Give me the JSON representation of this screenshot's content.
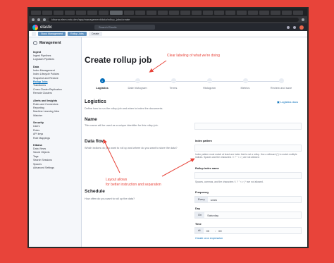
{
  "browser": {
    "url": "kibana.elem.extc.dev/app/management/data/rollup_jobs/create"
  },
  "header": {
    "brand": "elastic",
    "search_placeholder": "Search Elastic"
  },
  "breadcrumbs": [
    "Stack Management",
    "Rollup Jobs",
    "Create"
  ],
  "sidebar": {
    "title": "Management",
    "groups": [
      {
        "name": "Ingest",
        "items": [
          "Ingest Pipelines",
          "Logstash Pipelines"
        ]
      },
      {
        "name": "Data",
        "items": [
          "Index Management",
          "Index Lifecycle Policies",
          "Snapshot and Restore",
          "Rollup Jobs",
          "Transforms",
          "Cross-Cluster Replication",
          "Remote Clusters"
        ]
      },
      {
        "name": "Alerts and Insights",
        "items": [
          "Rules and Connectors",
          "Reporting",
          "Machine Learning Jobs",
          "Watcher"
        ]
      },
      {
        "name": "Security",
        "items": [
          "Users",
          "Roles",
          "API keys",
          "Role Mappings"
        ]
      },
      {
        "name": "Kibana",
        "items": [
          "Data Views",
          "Saved Objects",
          "Tags",
          "Search Sessions",
          "Spaces",
          "Advanced Settings"
        ]
      }
    ],
    "active_item": "Rollup Jobs"
  },
  "page": {
    "title": "Create rollup job"
  },
  "steps": [
    {
      "number": "1",
      "label": "Logistics",
      "active": true
    },
    {
      "label": "Date histogram"
    },
    {
      "label": "Terms"
    },
    {
      "label": "Histogram"
    },
    {
      "label": "Metrics"
    },
    {
      "label": "Review and save"
    }
  ],
  "logistics": {
    "title": "Logistics",
    "description": "Define how to run the rollup job and when to index the documents.",
    "docs_link": "Logistics docs"
  },
  "name_section": {
    "title": "Name",
    "description": "This name will be used as a unique identifier for this rollup job."
  },
  "dataflow_section": {
    "title": "Data flow",
    "description": "Which indices do you want to roll up and where do you want to store the data?",
    "index_pattern_label": "Index pattern",
    "index_pattern_help": "Index pattern must match at least one index that is not a rollup. Use a wildcard (*) to match multiple indices. Spaces and the characters \\ / ? \" < > | are not allowed.",
    "rollup_index_label": "Rollup index name",
    "rollup_index_help": "Spaces, commas, and the characters \\ / ? \" < > | * are not allowed."
  },
  "schedule_section": {
    "title": "Schedule",
    "description": "How often do you want to roll up the data?",
    "frequency_label": "Frequency",
    "frequency_prefix": "Every",
    "frequency_value": "week",
    "day_label": "Day",
    "day_prefix": "On",
    "day_value": "Saturday",
    "time_label": "Time",
    "time_prefix": "At",
    "time_hour": "00",
    "time_minute": "00",
    "cron_link": "Create cron expression"
  },
  "annotations": {
    "top": "Clear labeling of what we're doing",
    "bottom": "Layout allows\nfor better instruction and separation"
  },
  "colors": {
    "annotation": "#e8443a",
    "accent": "#006bb8",
    "header": "#25282f"
  }
}
